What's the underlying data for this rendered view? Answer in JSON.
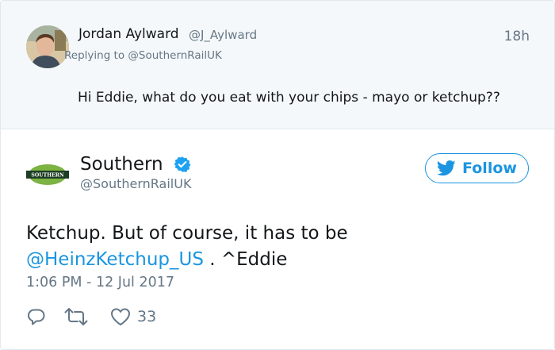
{
  "reply_tweet": {
    "author_name": "Jordan Aylward",
    "author_handle": "@J_Aylward",
    "time_ago": "18h",
    "replying_to": "Replying to @SouthernRailUK",
    "text": "Hi Eddie, what do you eat with your chips - mayo or ketchup??"
  },
  "main_tweet": {
    "author_name": "Southern",
    "author_handle": "@SouthernRailUK",
    "avatar_logo_text": "SOUTHERN",
    "follow_label": "Follow",
    "text_before": "Ketchup. But of course, it has to be",
    "mention": "@HeinzKetchup_US",
    "text_after": " . ^Eddie",
    "timestamp": "1:06 PM - 12 Jul 2017",
    "like_count": "33"
  },
  "colors": {
    "accent": "#1b95e0",
    "brand_green": "#7cb342",
    "brand_dark": "#1e3d24",
    "secondary_text": "#657786",
    "reply_background": "#f5f8fa"
  },
  "icons": {
    "verified": "verified-badge-icon",
    "follow": "twitter-bird-icon",
    "reply": "reply-icon",
    "retweet": "retweet-icon",
    "like": "heart-icon"
  }
}
